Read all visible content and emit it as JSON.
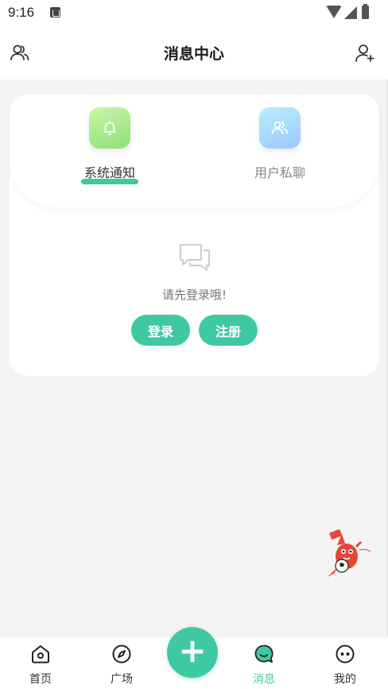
{
  "status_bar": {
    "time": "9:16"
  },
  "header": {
    "title": "消息中心"
  },
  "tabs": [
    {
      "label": "系统通知",
      "icon": "bell-icon",
      "active": true
    },
    {
      "label": "用户私聊",
      "icon": "users-icon",
      "active": false
    }
  ],
  "empty_state": {
    "text": "请先登录哦!",
    "login_label": "登录",
    "register_label": "注册"
  },
  "bottom_nav": {
    "items": [
      {
        "label": "首页",
        "icon": "home-icon"
      },
      {
        "label": "广场",
        "icon": "compass-icon"
      },
      {
        "label": "消息",
        "icon": "message-icon",
        "active": true
      },
      {
        "label": "我的",
        "icon": "profile-icon"
      }
    ],
    "fab_label": "+"
  },
  "colors": {
    "accent": "#3fc9a3",
    "background": "#f4f4f4"
  }
}
